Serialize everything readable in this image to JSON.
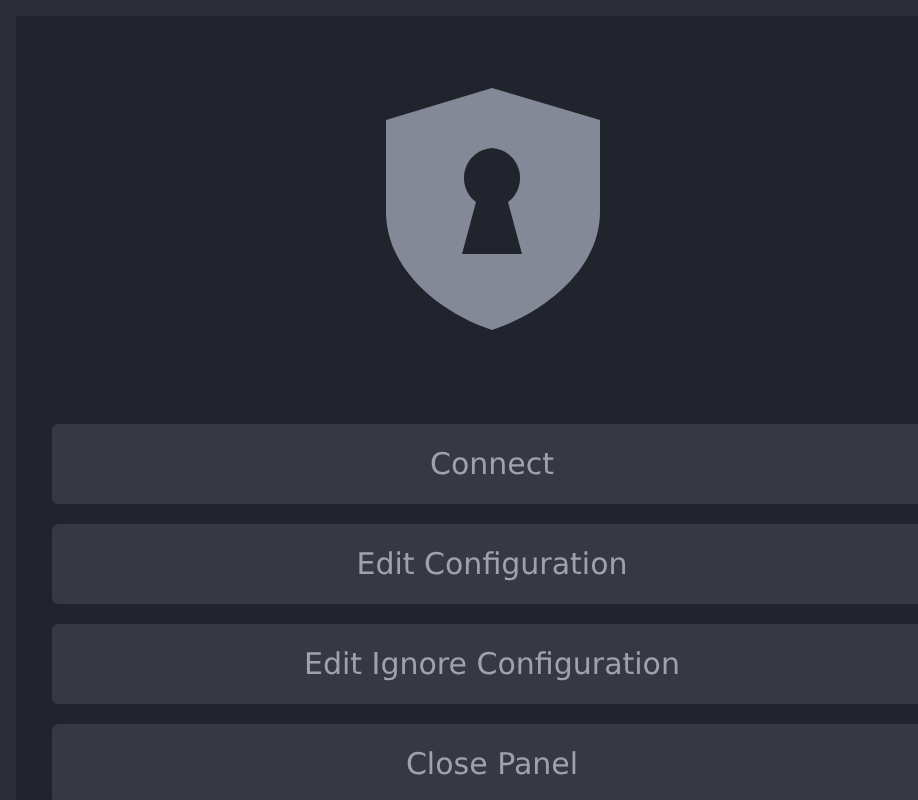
{
  "buttons": [
    {
      "label": "Connect"
    },
    {
      "label": "Edit Configuration"
    },
    {
      "label": "Edit Ignore Configuration"
    },
    {
      "label": "Close Panel"
    }
  ]
}
